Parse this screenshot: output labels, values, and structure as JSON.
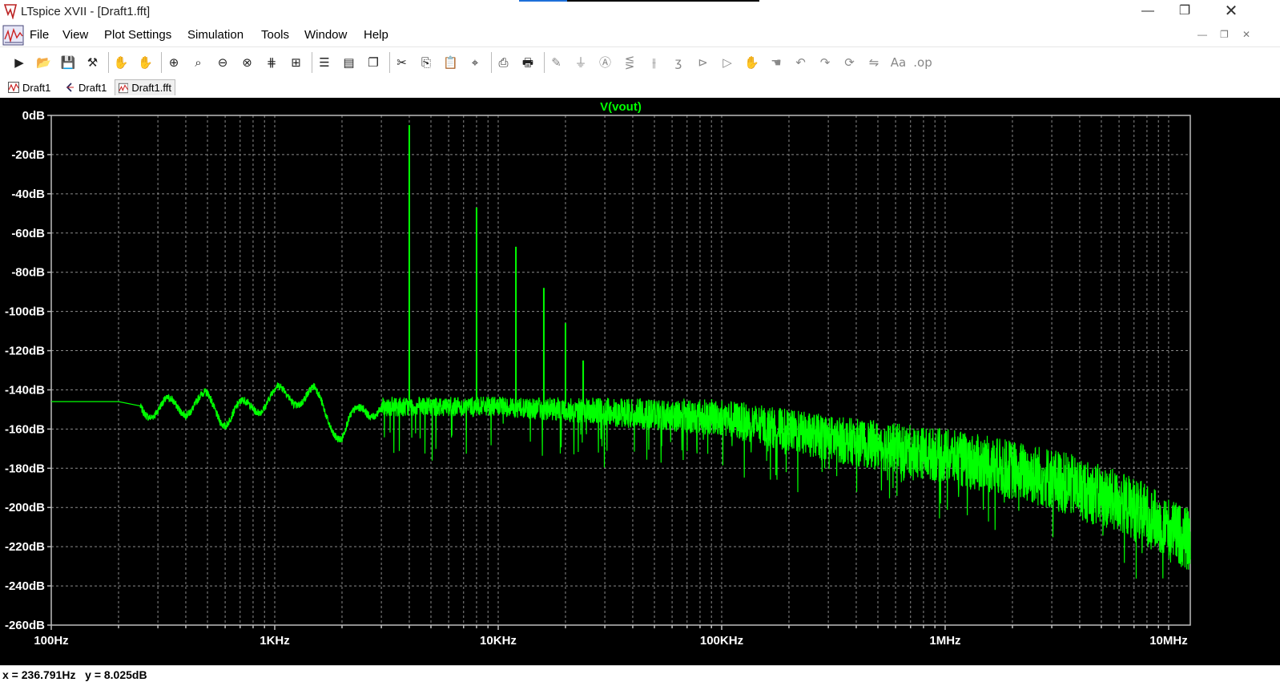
{
  "window": {
    "title": "LTspice XVII - [Draft1.fft]",
    "controls": [
      "minimize",
      "restore",
      "close"
    ]
  },
  "menu": {
    "items": [
      {
        "label": "File"
      },
      {
        "label": "View"
      },
      {
        "label": "Plot Settings"
      },
      {
        "label": "Simulation"
      },
      {
        "label": "Tools"
      },
      {
        "label": "Window"
      },
      {
        "label": "Help"
      }
    ]
  },
  "toolbar": {
    "buttons": [
      "run-icon",
      "open-icon",
      "save-icon",
      "control-panel-icon",
      "halt-icon",
      "pan-icon",
      "zoom-in-icon",
      "zoom-area-icon",
      "zoom-out-icon",
      "zoom-cancel-icon",
      "autorange-icon",
      "manual-limits-icon",
      "tile-horizontal-icon",
      "tile-vertical-icon",
      "cascade-icon",
      "cut-icon",
      "copy-icon",
      "paste-icon",
      "find-icon",
      "print-icon",
      "print-preview-icon",
      "wire-icon",
      "ground-icon",
      "label-net-icon",
      "resistor-icon",
      "capacitor-icon",
      "inductor-icon",
      "diode-icon",
      "component-icon",
      "move-icon",
      "drag-icon",
      "undo-icon",
      "redo-icon",
      "rotate-icon",
      "mirror-icon",
      "text-icon",
      "spice-directive-icon"
    ]
  },
  "tabs": [
    {
      "label": "Draft1",
      "icon": "waveform-icon",
      "active": false
    },
    {
      "label": "Draft1",
      "icon": "schematic-icon",
      "active": false
    },
    {
      "label": "Draft1.fft",
      "icon": "fft-icon",
      "active": true
    }
  ],
  "status": {
    "x_readout": "x = 236.791Hz",
    "y_readout": "y = 8.025dB"
  },
  "colors": {
    "plot_bg": "#000000",
    "trace": "#00ff00",
    "grid": "#8a8a8a",
    "axis_text": "#ffffff"
  },
  "chart_data": {
    "type": "line",
    "title": "V(vout)",
    "xscale": "log",
    "xlim": [
      100,
      12500000
    ],
    "ylim": [
      -260,
      0
    ],
    "x_ticks": [
      {
        "value": 100,
        "label": "100Hz"
      },
      {
        "value": 1000,
        "label": "1KHz"
      },
      {
        "value": 10000,
        "label": "10KHz"
      },
      {
        "value": 100000,
        "label": "100KHz"
      },
      {
        "value": 1000000,
        "label": "1MHz"
      },
      {
        "value": 10000000,
        "label": "10MHz"
      }
    ],
    "y_ticks": [
      {
        "value": 0,
        "label": "0dB"
      },
      {
        "value": -20,
        "label": "-20dB"
      },
      {
        "value": -40,
        "label": "-40dB"
      },
      {
        "value": -60,
        "label": "-60dB"
      },
      {
        "value": -80,
        "label": "-80dB"
      },
      {
        "value": -100,
        "label": "-100dB"
      },
      {
        "value": -120,
        "label": "-120dB"
      },
      {
        "value": -140,
        "label": "-140dB"
      },
      {
        "value": -160,
        "label": "-160dB"
      },
      {
        "value": -180,
        "label": "-180dB"
      },
      {
        "value": -200,
        "label": "-200dB"
      },
      {
        "value": -220,
        "label": "-220dB"
      },
      {
        "value": -240,
        "label": "-240dB"
      },
      {
        "value": -260,
        "label": "-260dB"
      }
    ],
    "grid": true,
    "series": [
      {
        "name": "V(vout)",
        "color": "#00ff00",
        "noise_floor": [
          [
            100,
            -146
          ],
          [
            200,
            -146
          ],
          [
            300,
            -150
          ],
          [
            500,
            -146
          ],
          [
            600,
            -154
          ],
          [
            800,
            -148
          ],
          [
            1000,
            -143
          ],
          [
            1500,
            -143
          ],
          [
            2000,
            -164
          ],
          [
            2500,
            -148
          ],
          [
            3000,
            -150
          ],
          [
            10000,
            -150
          ],
          [
            100000,
            -157
          ],
          [
            300000,
            -168
          ],
          [
            1000000,
            -178
          ],
          [
            3000000,
            -190
          ],
          [
            7000000,
            -205
          ],
          [
            12500000,
            -222
          ]
        ],
        "peaks": [
          {
            "x": 4000,
            "y": -5
          },
          {
            "x": 8000,
            "y": -47
          },
          {
            "x": 12000,
            "y": -67
          },
          {
            "x": 16000,
            "y": -88
          },
          {
            "x": 20000,
            "y": -106
          },
          {
            "x": 24000,
            "y": -125
          }
        ]
      }
    ]
  }
}
